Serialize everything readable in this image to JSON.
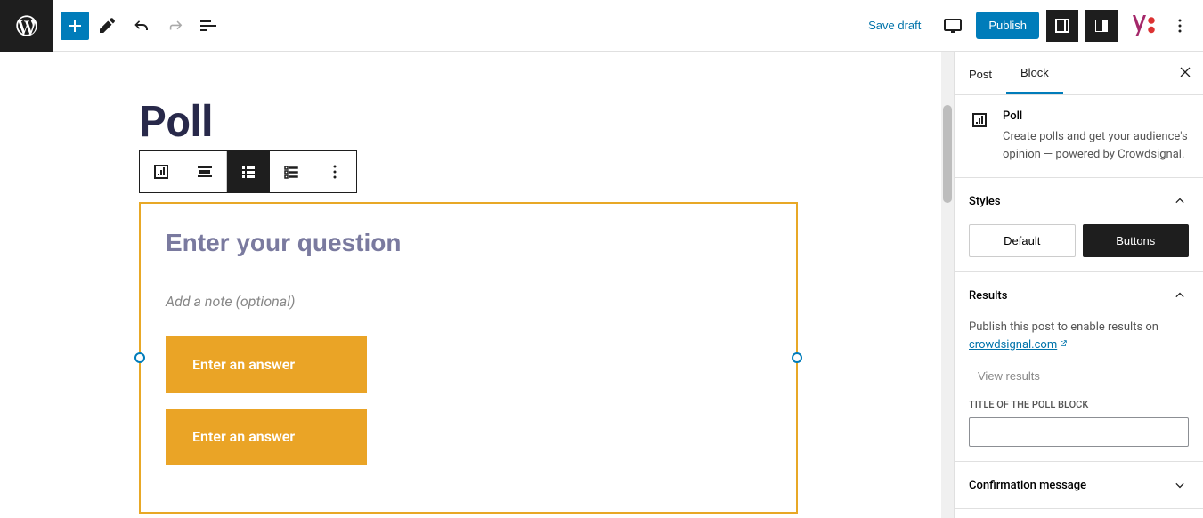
{
  "topbar": {
    "save_draft": "Save draft",
    "publish": "Publish"
  },
  "post": {
    "title": "Poll"
  },
  "poll": {
    "question_placeholder": "Enter your question",
    "note": "Add a note (optional)",
    "answers": [
      "Enter an answer",
      "Enter an answer"
    ]
  },
  "sidebar": {
    "tab_post": "Post",
    "tab_block": "Block",
    "block_name": "Poll",
    "block_desc": "Create polls and get your audience's opinion — powered by Crowdsignal.",
    "styles": {
      "title": "Styles",
      "options": [
        "Default",
        "Buttons"
      ]
    },
    "results": {
      "title": "Results",
      "text_pre": "Publish this post to enable results on ",
      "link": "crowdsignal.com",
      "view_results": "View results",
      "input_label": "Title of the Poll Block"
    },
    "confirmation": {
      "title": "Confirmation message"
    }
  },
  "colors": {
    "accent": "#007cba",
    "poll_border": "#e8a826",
    "poll_btn": "#eaa426"
  }
}
